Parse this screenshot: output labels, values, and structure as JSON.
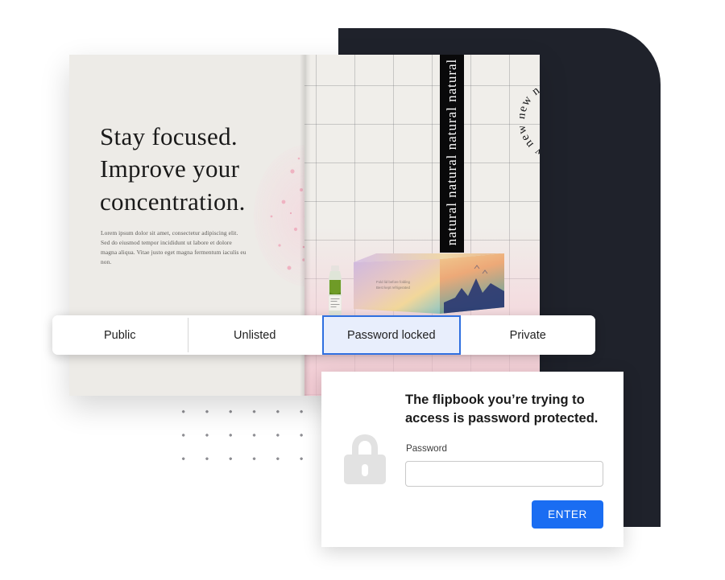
{
  "magazine": {
    "left_page": {
      "headline_lines": [
        "Stay focused.",
        "Improve your",
        "concentration."
      ],
      "headline": "Stay focused. Improve your concentration.",
      "body_text": "Lorem ipsum dolor sit amet, consectetur adipiscing elit. Sed do eiusmod tempor incididunt ut labore et dolore magna aliqua. Vitae justo eget magna fermentum iaculis eu non."
    },
    "right_page": {
      "vertical_strip_text": "natural natural natural natural",
      "vertical_strip_word": "natural",
      "circular_text": "new new new new new new new",
      "circular_word": "new",
      "product_box_text_line1": "Fold lid before folding",
      "product_box_text_line2": "Best kept refrigerated",
      "bottle_label": "juice"
    }
  },
  "visibility_tabs": {
    "items": [
      {
        "label": "Public",
        "selected": false
      },
      {
        "label": "Unlisted",
        "selected": false
      },
      {
        "label": "Password locked",
        "selected": true
      },
      {
        "label": "Private",
        "selected": false
      }
    ],
    "selected_label": "Password locked"
  },
  "password_dialog": {
    "title": "The flipbook you’re trying to access is password protected.",
    "title_line1": "The flipbook you’re trying to",
    "title_line2": "access is password protected.",
    "field_label": "Password",
    "field_value": "",
    "field_placeholder": "",
    "submit_label": "ENTER",
    "lock_icon": "lock-icon"
  },
  "colors": {
    "accent_blue": "#1a6df2",
    "selected_tab_fill": "#e8eefc",
    "selected_tab_border": "#2f6fe0",
    "dark_panel": "#1f222b",
    "page_cream": "#edebe7",
    "lock_gray": "#e2e2e2",
    "dot_gray": "#8d8d92"
  }
}
